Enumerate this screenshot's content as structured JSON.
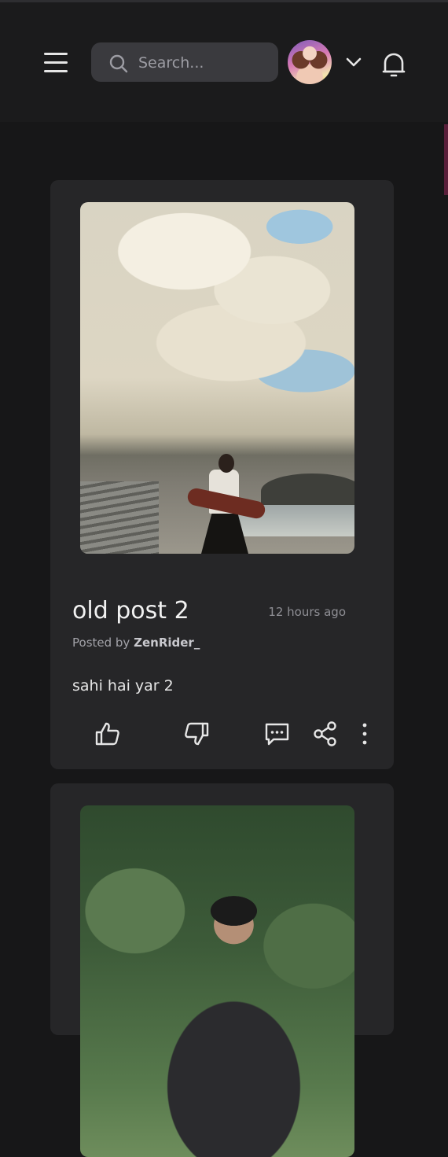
{
  "header": {
    "search": {
      "placeholder": "Search..."
    },
    "icons": {
      "menu": "hamburger-icon",
      "search": "search-icon",
      "avatar": "user-avatar",
      "dropdown": "chevron-down-icon",
      "notifications": "bell-icon"
    }
  },
  "posts": [
    {
      "title": "old post 2",
      "time": "12 hours ago",
      "posted_by_prefix": "Posted by",
      "author": "ZenRider_",
      "body": "sahi hai yar 2",
      "actions": [
        "thumbs-up-icon",
        "thumbs-down-icon",
        "comment-icon",
        "share-icon",
        "more-vertical-icon"
      ]
    },
    {
      "title": "",
      "time": "",
      "author": "",
      "body": ""
    }
  ],
  "colors": {
    "background": "#171718",
    "header": "#1b1b1c",
    "card": "#262628",
    "search": "#3a3a3e"
  }
}
